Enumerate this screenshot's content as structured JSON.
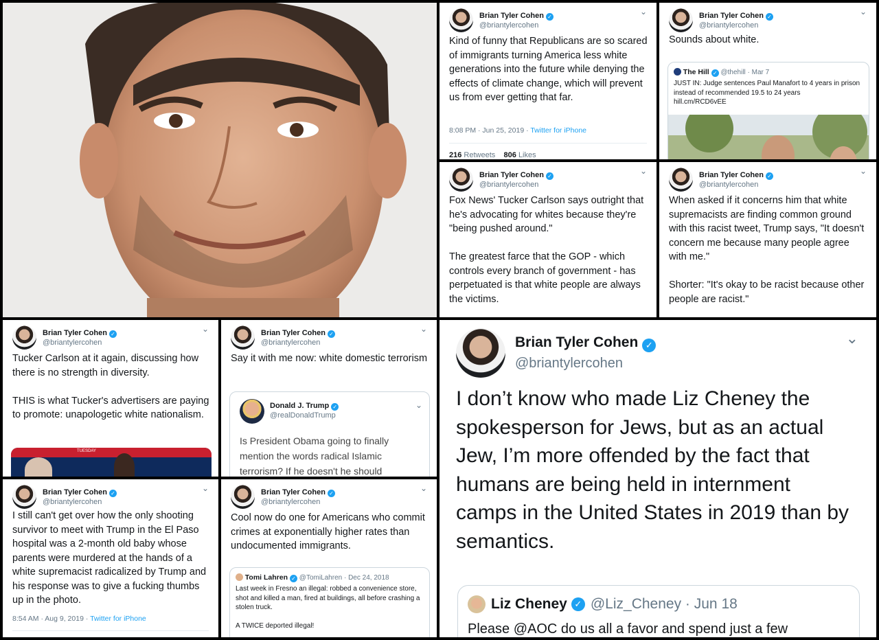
{
  "photo": {
    "description": ""
  },
  "tweets": [
    {
      "name": "Brian Tyler Cohen",
      "handle": "@briantylercohen",
      "text": "Kind of funny that Republicans are so scared of immigrants turning America less white generations into the future while denying the effects of climate change, which will prevent us from ever getting that far.",
      "time": "8:08 PM · Jun 25, 2019 ·",
      "source": "Twitter for iPhone",
      "retweets": "216",
      "retweets_label": "Retweets",
      "likes": "806",
      "likes_label": "Likes"
    },
    {
      "name": "Brian Tyler Cohen",
      "handle": "@briantylercohen",
      "text": "Sounds about white.",
      "quote": {
        "name": "The Hill",
        "handle": "@thehill · Mar 7",
        "text": "JUST IN: Judge sentences Paul Manafort to 4 years in prison instead of recommended 19.5 to 24 years\nhill.cm/RCD6vEE"
      }
    },
    {
      "name": "Brian Tyler Cohen",
      "handle": "@briantylercohen",
      "text": "Fox News' Tucker Carlson says outright that he's advocating for whites because they're \"being pushed around.\"\n\nThe greatest farce that the GOP - which controls every branch of government - has perpetuated is that white people are always the victims."
    },
    {
      "name": "Brian Tyler Cohen",
      "handle": "@briantylercohen",
      "text": "When asked if it concerns him that white supremacists are finding common ground with this racist tweet, Trump says, \"It doesn't concern me because many people agree with me.\"\n\nShorter: \"It's okay to be racist because other people are racist.\""
    },
    {
      "name": "Brian Tyler Cohen",
      "handle": "@briantylercohen",
      "text": "Tucker Carlson at it again, discussing how there is no strength in diversity.\n\nTHIS is what Tucker's advertisers are paying to promote: unapologetic white nationalism.",
      "media_label": "TUESDAY"
    },
    {
      "name": "Brian Tyler Cohen",
      "handle": "@briantylercohen",
      "text": "Say it with me now: white domestic terrorism",
      "quote": {
        "name": "Donald J. Trump",
        "handle": "@realDonaldTrump",
        "text": "Is President Obama going to finally mention the words radical Islamic terrorism? If he doesn't he should"
      }
    },
    {
      "name": "Brian Tyler Cohen",
      "handle": "@briantylercohen",
      "text": "I still can't get over how the only shooting survivor to meet with Trump in the El Paso hospital was a 2-month old baby whose parents were murdered at the hands of a white supremacist radicalized by Trump and his response was to give a fucking thumbs up in the photo.",
      "time": "8:54 AM · Aug 9, 2019 ·",
      "source": "Twitter for iPhone"
    },
    {
      "name": "Brian Tyler Cohen",
      "handle": "@briantylercohen",
      "text": "Cool now do one for Americans who commit crimes at exponentially higher rates than undocumented immigrants.",
      "quote": {
        "name": "Tomi Lahren",
        "handle": "@TomiLahren · Dec 24, 2018",
        "text": "Last week in Fresno an illegal: robbed a convenience store, shot and killed a man, fired at buildings, all before crashing a stolen truck.\n\nA TWICE deported illegal!"
      }
    },
    {
      "name": "Brian Tyler Cohen",
      "handle": "@briantylercohen",
      "text": "I don’t know who made Liz Cheney the spokesperson for Jews, but as an actual Jew, I’m more offended by the fact that humans are being held in internment camps in the United States in 2019 than by semantics.",
      "quote": {
        "name": "Liz Cheney",
        "handle": "@Liz_Cheney · Jun 18",
        "text": "Please @AOC do us all a favor and spend just a few"
      }
    }
  ],
  "icons": {
    "verified": "✓",
    "chevron": "⌄"
  },
  "colors": {
    "link": "#1da1f2",
    "secondary": "#657786"
  }
}
